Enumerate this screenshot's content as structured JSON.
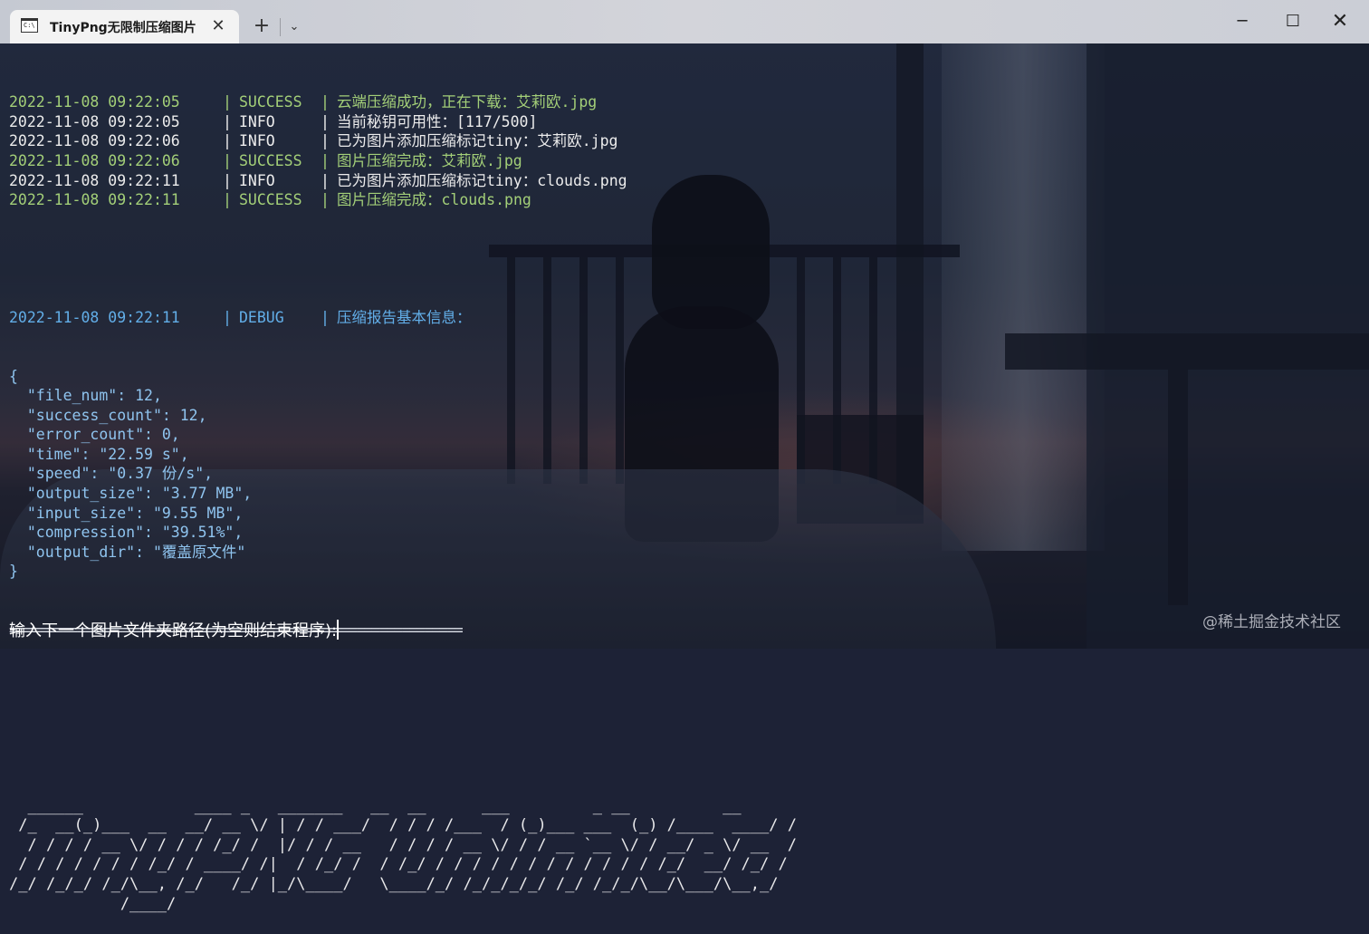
{
  "window": {
    "tab_title": "TinyPng无限制压缩图片",
    "tab_icon_glyph": "C:\\",
    "close_tab_glyph": "✕",
    "new_tab_glyph": "+",
    "dropdown_glyph": "⌄",
    "minimize_glyph": "─",
    "maximize_glyph": "☐",
    "close_glyph": "✕"
  },
  "log": [
    {
      "time": "2022-11-08 09:22:05",
      "sep": "|",
      "level": "SUCCESS",
      "message": "云端压缩成功，正在下载：艾莉欧.jpg",
      "color": "#a3cf78"
    },
    {
      "time": "2022-11-08 09:22:05",
      "sep": "|",
      "level": "INFO",
      "message": "当前秘钥可用性：[117/500]",
      "color": "#ececec"
    },
    {
      "time": "2022-11-08 09:22:06",
      "sep": "|",
      "level": "INFO",
      "message": "已为图片添加压缩标记tiny：艾莉欧.jpg",
      "color": "#ececec"
    },
    {
      "time": "2022-11-08 09:22:06",
      "sep": "|",
      "level": "SUCCESS",
      "message": "图片压缩完成：艾莉欧.jpg",
      "color": "#a3cf78"
    },
    {
      "time": "2022-11-08 09:22:11",
      "sep": "|",
      "level": "INFO",
      "message": "已为图片添加压缩标记tiny：clouds.png",
      "color": "#ececec"
    },
    {
      "time": "2022-11-08 09:22:11",
      "sep": "|",
      "level": "SUCCESS",
      "message": "图片压缩完成：clouds.png",
      "color": "#a3cf78"
    }
  ],
  "debug": {
    "time": "2022-11-08 09:22:11",
    "sep": "|",
    "level": "DEBUG",
    "message": "压缩报告基本信息：",
    "color": "#62aee8"
  },
  "report_lines": [
    "{",
    "  \"file_num\": 12,",
    "  \"success_count\": 12,",
    "  \"error_count\": 0,",
    "  \"time\": \"22.59 s\",",
    "  \"speed\": \"0.37 份/s\",",
    "  \"output_size\": \"3.77 MB\",",
    "  \"input_size\": \"9.55 MB\",",
    "  \"compression\": \"39.51%\",",
    "  \"output_dir\": \"覆盖原文件\"",
    "}"
  ],
  "rule": "============================================================",
  "banner": [
    "  ______            ____ _   _______   __  __      ___         _ __          __",
    " /_  __(_)___  __  __/ __ \\/ | / / ___/  / / / /___  / (_)___ ___  (_) /____  ____/ /",
    "  / / / / __ \\/ / / / /_/ /  |/ / / __   / / / / __ \\/ / / __ `__ \\/ / __/ _ \\/ __  /",
    " / / / / / / / /_/ / ____/ /|  / /_/ /  / /_/ / / / / / / / / / / / / /_/  __/ /_/ /",
    "/_/ /_/_/ /_/\\__, /_/   /_/ |_/\\____/   \\____/_/ /_/_/_/_/ /_/ /_/_/\\__/\\___/\\__,_/",
    "            /____/"
  ],
  "prompt": "输入下一个图片文件夹路径(为空则结束程序):",
  "watermark": "@稀土掘金技术社区",
  "colors": {
    "success": "#a3cf78",
    "info": "#ececec",
    "debug": "#62aee8",
    "json": "#8fc4ef"
  }
}
